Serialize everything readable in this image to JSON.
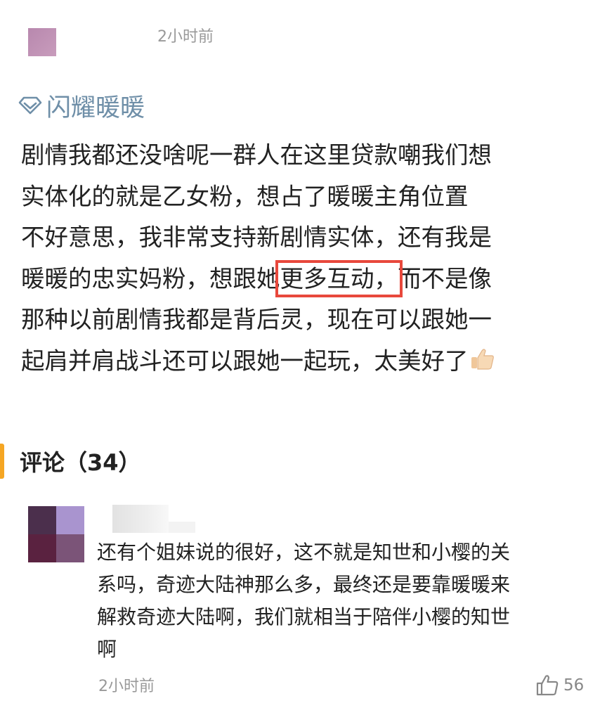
{
  "post": {
    "time": "2小时前",
    "topic": "闪耀暖暖",
    "lines": {
      "l1": "剧情我都还没啥呢一群人在这里贷款嘲我们想",
      "l2": "实体化的就是乙女粉，想占了暖暖主角位置",
      "l3": "不好意思，我非常支持新剧情实体，还有我是",
      "l4_before": "暖暖的忠实妈粉，想跟她",
      "l4_highlight": "更多互动，",
      "l4_after": "而不是像",
      "l5": "那种以前剧情我都是背后灵，现在可以跟她一",
      "l6": "起肩并肩战斗还可以跟她一起玩，太美好了"
    }
  },
  "comments_section": {
    "title": "评论（34）"
  },
  "comment": {
    "lines": [
      "还有个姐妹说的很好，这不就是知世和小樱的关",
      "系吗，奇迹大陆神那么多，最终还是要靠暖暖来",
      "解救奇迹大陆啊，我们就相当于陪伴小樱的知世",
      "啊"
    ],
    "time": "2小时前",
    "likes": "56",
    "avatar_colors": [
      "#4b2f4c",
      "#a994cf",
      "#5a2240",
      "#7b5478"
    ]
  },
  "colors": {
    "topic": "#6f8fa8",
    "highlight_box": "#e8483c",
    "section_accent": "#f5a623",
    "muted_text": "#999999"
  },
  "icons": {
    "topic": "diamond-icon",
    "emoji": "thumbs-up-emoji",
    "like": "thumbs-up-icon"
  }
}
